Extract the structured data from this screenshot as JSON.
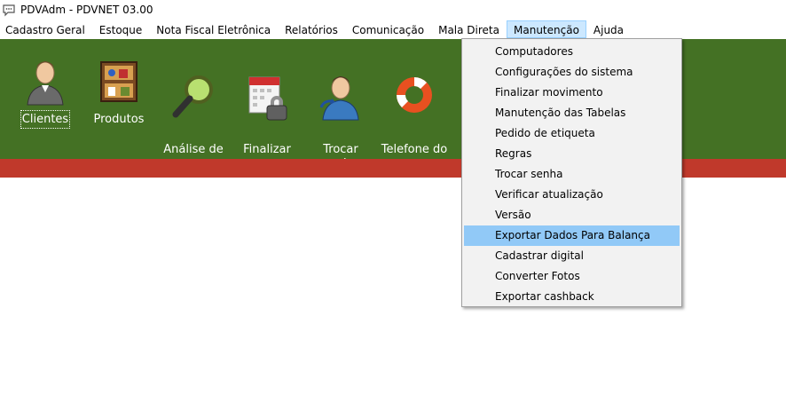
{
  "window": {
    "title": "PDVAdm - PDVNET 03.00",
    "icon": "chat-bubble-icon"
  },
  "menubar": {
    "items": [
      {
        "label": "Cadastro Geral"
      },
      {
        "label": "Estoque"
      },
      {
        "label": "Nota Fiscal Eletrônica"
      },
      {
        "label": "Relatórios"
      },
      {
        "label": "Comunicação"
      },
      {
        "label": "Mala Direta"
      },
      {
        "label": "Manutenção",
        "active": true
      },
      {
        "label": "Ajuda"
      }
    ]
  },
  "toolbar": {
    "colors": {
      "background": "#447124",
      "strip": "#c0392b"
    },
    "buttons": [
      {
        "label": "Clientes",
        "icon": "person-icon"
      },
      {
        "label": "Produtos",
        "icon": "shelf-icon"
      },
      {
        "label": "Análise de\nProduto",
        "icon": "magnifier-icon"
      },
      {
        "label": "Finalizar\nMovimento",
        "icon": "calendar-lock-icon"
      },
      {
        "label": "Trocar\nUsuário",
        "icon": "user-switch-icon"
      },
      {
        "label": "Telefone do\nSuporte",
        "icon": "lifebuoy-icon"
      }
    ]
  },
  "dropdown": {
    "items": [
      {
        "label": "Computadores"
      },
      {
        "label": "Configurações do sistema"
      },
      {
        "label": "Finalizar movimento"
      },
      {
        "label": "Manutenção das Tabelas"
      },
      {
        "label": "Pedido de etiqueta"
      },
      {
        "label": "Regras"
      },
      {
        "label": "Trocar senha"
      },
      {
        "label": "Verificar atualização"
      },
      {
        "label": "Versão"
      },
      {
        "label": "Exportar Dados Para Balança",
        "highlighted": true
      },
      {
        "label": "Cadastrar digital"
      },
      {
        "label": "Converter Fotos"
      },
      {
        "label": "Exportar cashback"
      }
    ]
  }
}
